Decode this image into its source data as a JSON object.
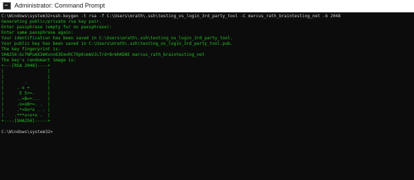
{
  "window": {
    "title": "Administrator: Command Prompt"
  },
  "console": {
    "lines": [
      {
        "text": "C:\\Windows\\system32>ssh-keygen -t rsa -f C:\\Users\\mrath\\.ssh\\testing_os_login_3rd_party_tool -C marcus_rath_braintesting_net -b 2048",
        "color": "#cccccc"
      },
      {
        "text": "Generating public/private rsa key pair.",
        "color": "#22c322"
      },
      {
        "text": "Enter passphrase (empty for no passphrase):",
        "color": "#22c322"
      },
      {
        "text": "Enter same passphrase again:",
        "color": "#22c322"
      },
      {
        "text": "Your identification has been saved in C:\\Users\\mrath\\.ssh\\testing_os_login_3rd_party_tool.",
        "color": "#22c322"
      },
      {
        "text": "Your public key has been saved in C:\\Users\\mrath\\.ssh\\testing_os_login_3rd_party_tool.pub.",
        "color": "#22c322"
      },
      {
        "text": "The key fingerprint is:",
        "color": "#22c322"
      },
      {
        "text": "SHA256:Gc7NPuAX3mKvnn63EmvRC70pKcmmVJLTrd+BrmhKD8E marcus_rath_braintesting_net",
        "color": "#22c322"
      },
      {
        "text": "The key's randomart image is:",
        "color": "#22c322"
      },
      {
        "text": "+---[RSA 2048]----+",
        "color": "#22c322"
      },
      {
        "text": "|                 |",
        "color": "#22c322"
      },
      {
        "text": "|                 |",
        "color": "#22c322"
      },
      {
        "text": "|        .        |",
        "color": "#22c322"
      },
      {
        "text": "|     . o =       |",
        "color": "#22c322"
      },
      {
        "text": "|      E S+=.     |",
        "color": "#22c322"
      },
      {
        "text": "|     ..=B=+...   |",
        "color": "#22c322"
      },
      {
        "text": "|     .o=oB+=. .  |",
        "color": "#22c322"
      },
      {
        "text": "|     .*=Oo*o . . |",
        "color": "#22c322"
      },
      {
        "text": "|    .***o+o+o .  |",
        "color": "#22c322"
      },
      {
        "text": "+----[SHA256]-----+",
        "color": "#22c322"
      },
      {
        "text": "",
        "color": "#cccccc"
      },
      {
        "text": "C:\\Windows\\system32>",
        "color": "#cccccc"
      }
    ]
  }
}
